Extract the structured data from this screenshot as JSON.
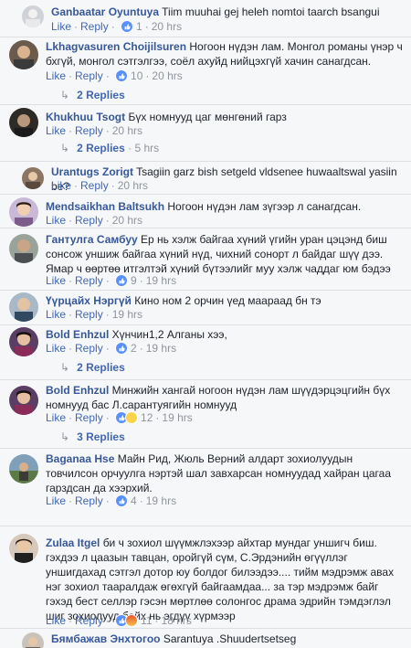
{
  "action_labels": {
    "like": "Like",
    "reply": "Reply"
  },
  "colors": {
    "link": "#365899",
    "action": "#4267b2",
    "meta": "#90949c"
  },
  "comments": [
    {
      "author": "Ganbaatar Oyuntuya",
      "text": "Tiim muuhai gej heleh nomtoi taarch bsangui",
      "reactions": "1",
      "time": "20 hrs",
      "reaction_icons": [
        "like-icon"
      ]
    },
    {
      "author": "Lkhagvasuren Choijilsuren",
      "text": "Ногоон нүдэн лам. Монгол романы үнэр ч бхгүй, монгол сэтгэлгээ, соёл ахуйд нийцэхгүй хачин санагдсан.",
      "reactions": "10",
      "time": "20 hrs",
      "reaction_icons": [
        "like-icon"
      ],
      "replies_label": "2 Replies"
    },
    {
      "author": "Khukhuu Tsogt",
      "text": "Бүх номнууд цаг мөнгөний гарз",
      "reactions": "",
      "time": "20 hrs",
      "replies_label": "2 Replies",
      "replies_time": "5 hrs"
    },
    {
      "author": "Urantugs Zorigt",
      "text": "Tsagiin garz bish setgeld vldsenee huwaaltswal yasiin be?",
      "reactions": "",
      "time": "20 hrs"
    },
    {
      "author": "Mendsaikhan Baltsukh",
      "text": "Ногоон нүдэн лам зүгээр л санагдсан.",
      "reactions": "",
      "time": "20 hrs"
    },
    {
      "author": "Гантулга Самбуу",
      "text": "Ер нь хэлж байгаа хүний үгийн уран цэцэнд биш сонсож уншиж байгаа хүний нүд, чихний сонорт л байдаг шүү дээ. Ямар ч өөртөө итгэлтэй хүний бүтээлийг муу хэлж чаддаг юм бэдээ",
      "reactions": "9",
      "time": "19 hrs",
      "reaction_icons": [
        "like-icon"
      ]
    },
    {
      "author": "Үүрцайх Нэргүй",
      "text": "Кино ном 2 орчин үед маараад бн тэ",
      "reactions": "",
      "time": "19 hrs"
    },
    {
      "author": "Bold Enhzul",
      "text": "Хүнчин1,2 Алганы хээ,",
      "reactions": "2",
      "time": "19 hrs",
      "reaction_icons": [
        "like-icon"
      ],
      "replies_label": "2 Replies"
    },
    {
      "author": "Bold Enhzul",
      "text": "Минжийн хангай ногоон нүдэн лам шүүдэрцэцгийн бүх номнууд бас Л.сарантуягийн номнууд",
      "reactions": "12",
      "time": "19 hrs",
      "reaction_icons": [
        "like-icon",
        "haha-icon"
      ],
      "replies_label": "3 Replies"
    },
    {
      "author": "Baganaa Hse",
      "text": "Майн Рид, Жюль Верний алдарт зохиолуудын товчилсон орчуулга нэртэй шал завхарсан номнуудад хайран цагаа гарздсан да хээрхий.",
      "reactions": "4",
      "time": "19 hrs",
      "reaction_icons": [
        "like-icon"
      ]
    },
    {
      "author": "Zulaa Itgel",
      "text": "би ч зохиол шүүмжлэхээр айхтар мундаг уншигч биш. гэхдээ л цаазын тавцан, оройгүй сүм, С.Эрдэнийн өгүүллэг уншигдахад сэтгэл дотор юу болдог билээдээ.... тийм мэдрэмж авах нэг зохиол тааралдаж өгөхгүй байгаамдаа... за тэр мэдрэмж байг гэхэд бест селлэр гэсэн мөртлөө солонгос драма эдрийн тэмдэглэл шиг зохиолууд байх нь эгдүү хүрмээр",
      "reactions": "11",
      "time": "18 hrs",
      "reaction_icons": [
        "like-icon",
        "angry-icon"
      ]
    },
    {
      "author": "Бямбажав Энхтогоо",
      "text": "Sarantuya .Shuudertsetseg",
      "reactions": "",
      "time": ""
    }
  ]
}
